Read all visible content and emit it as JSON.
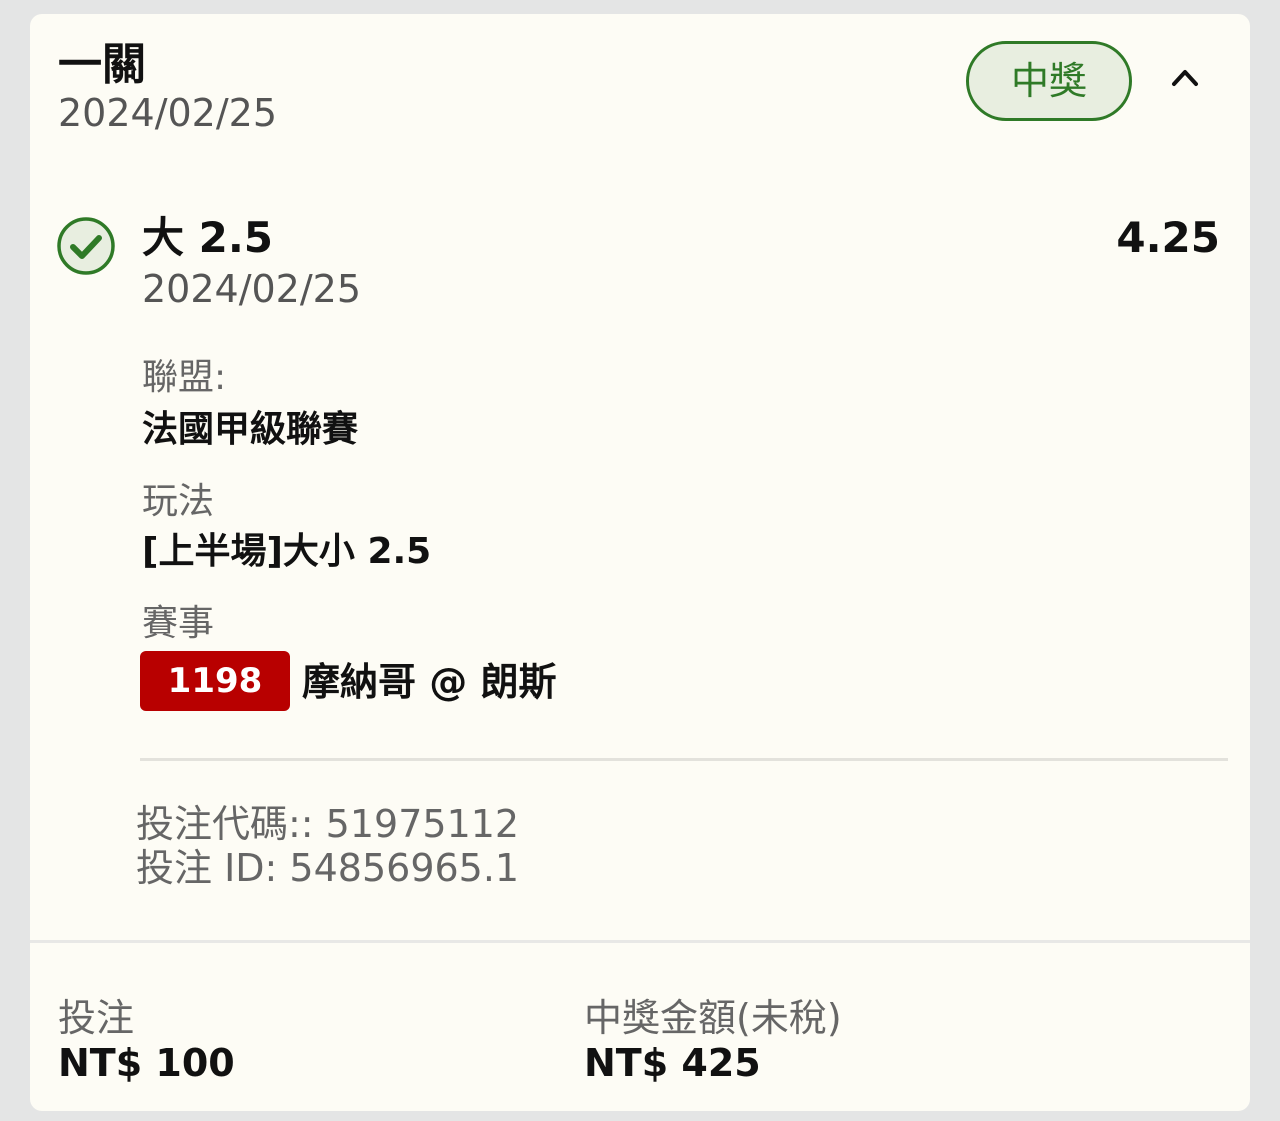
{
  "header": {
    "bet_type": "一關",
    "date": "2024/02/25",
    "status": "中獎",
    "collapse_icon": "chevron-up-icon"
  },
  "selection": {
    "status_icon": "check-circle-icon",
    "name": "大 2.5",
    "date": "2024/02/25",
    "odds": "4.25",
    "league_label": "聯盟:",
    "league_value": "法國甲級聯賽",
    "market_label": "玩法",
    "market_value": "[上半場]大小 2.5",
    "event_label": "賽事",
    "event_number": "1198",
    "event_name": "摩納哥 @ 朗斯",
    "bet_code_line": "投注代碼:: 51975112",
    "bet_id_line": "投注 ID: 54856965.1"
  },
  "footer": {
    "stake_label": "投注",
    "stake_value": "NT$ 100",
    "payout_label": "中獎金額(未稅)",
    "payout_value": "NT$ 425"
  },
  "colors": {
    "card_bg": "#fdfcf5",
    "page_bg": "#e4e5e5",
    "win_green": "#2f7a27",
    "badge_red": "#b80000"
  }
}
